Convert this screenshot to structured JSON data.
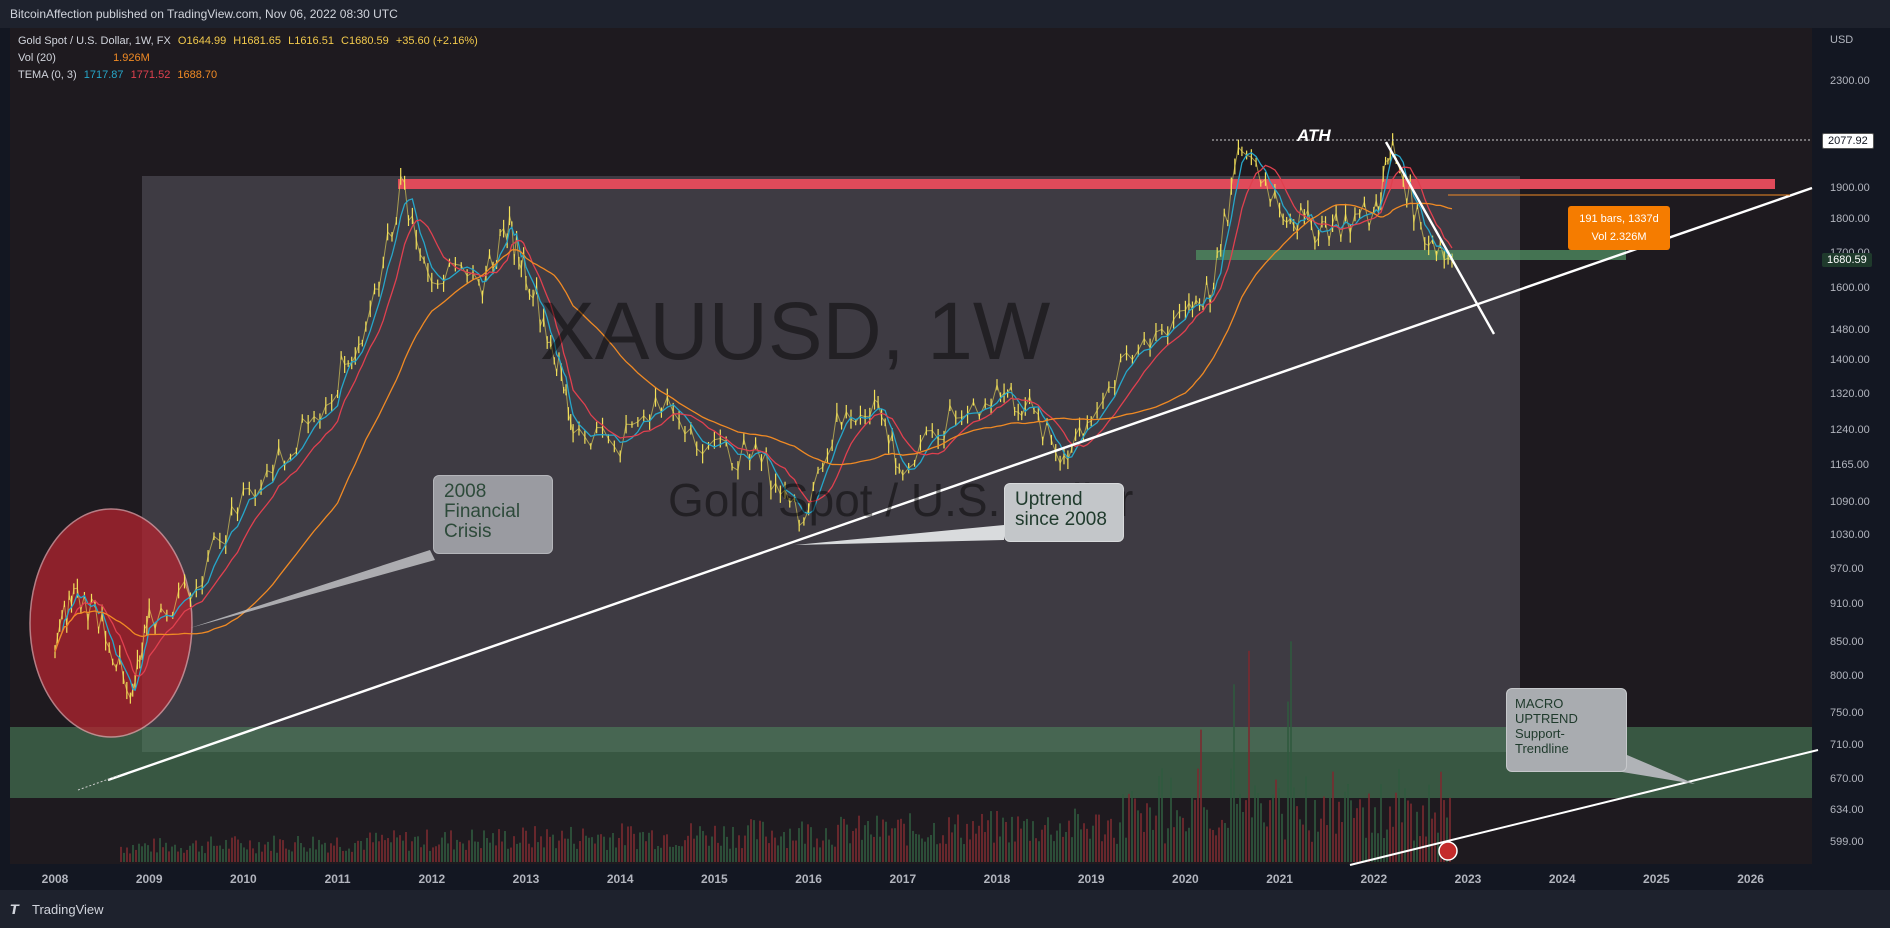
{
  "header": {
    "published": "BitcoinAffection published on TradingView.com, Nov 06, 2022 08:30 UTC"
  },
  "legend": {
    "symbol": "Gold Spot / U.S. Dollar, 1W, FX",
    "ohlc": [
      "O1644.99",
      "H1681.65",
      "L1616.51",
      "C1680.59",
      "+35.60 (+2.16%)"
    ],
    "vol_label": "Vol (20)",
    "vol_value": "1.926M",
    "tema_label": "TEMA (0, 3)",
    "tema_values": [
      "1717.87",
      "1771.52",
      "1688.70"
    ]
  },
  "watermark": {
    "ticker": "XAUUSD, 1W",
    "name": "Gold Spot / U.S. Dollar"
  },
  "annotations": {
    "ath": "ATH",
    "crisis": [
      "2008",
      "Financial",
      "Crisis"
    ],
    "uptrend": [
      "Uptrend",
      "since 2008"
    ],
    "macro": [
      "MACRO",
      "UPTREND",
      "Support-",
      "Trendline"
    ],
    "bars_box": [
      "191 bars, 1337d",
      "Vol 2.326M"
    ]
  },
  "axis": {
    "currency": "USD",
    "price_ticks": [
      "2300.00",
      "2077.92",
      "1900.00",
      "1800.00",
      "1700.00",
      "1600.00",
      "1480.00",
      "1400.00",
      "1320.00",
      "1240.00",
      "1165.00",
      "1090.00",
      "1030.00",
      "970.00",
      "910.00",
      "850.00",
      "800.00",
      "750.00",
      "710.00",
      "670.00",
      "634.00",
      "599.00"
    ],
    "time_ticks": [
      "2008",
      "2009",
      "2010",
      "2011",
      "2012",
      "2013",
      "2014",
      "2015",
      "2016",
      "2017",
      "2018",
      "2019",
      "2020",
      "2021",
      "2022",
      "2023",
      "2024",
      "2025",
      "2026"
    ],
    "ath_badge": "2077.92",
    "last_badge": "1680.59"
  },
  "footer": {
    "brand": "TradingView"
  },
  "colors": {
    "price": "#f2e05a",
    "tema_fast": "#26a6c9",
    "tema_mid": "#e0404f",
    "tema_slow": "#f08a24",
    "resistance": "#e04a5a",
    "support_zone": "#4e8a5f"
  },
  "chart_data": {
    "type": "line",
    "title": "Gold Spot / U.S. Dollar, 1W, FX",
    "x": [
      2008.0,
      2008.2,
      2008.5,
      2008.8,
      2009.0,
      2009.5,
      2010.0,
      2010.5,
      2011.0,
      2011.3,
      2011.67,
      2012.0,
      2012.5,
      2012.8,
      2013.0,
      2013.3,
      2013.5,
      2014.0,
      2014.5,
      2015.0,
      2015.5,
      2015.9,
      2016.3,
      2016.7,
      2017.0,
      2017.5,
      2018.0,
      2018.3,
      2018.67,
      2019.0,
      2019.5,
      2020.0,
      2020.3,
      2020.6,
      2021.0,
      2021.3,
      2021.6,
      2022.0,
      2022.2,
      2022.5,
      2022.83
    ],
    "series": [
      {
        "values": [
          850,
          930,
          890,
          760,
          880,
          950,
          1100,
          1200,
          1360,
          1480,
          1900,
          1650,
          1600,
          1780,
          1660,
          1420,
          1250,
          1220,
          1300,
          1200,
          1180,
          1060,
          1250,
          1310,
          1150,
          1260,
          1330,
          1300,
          1180,
          1280,
          1420,
          1550,
          1600,
          2060,
          1850,
          1780,
          1790,
          1820,
          2040,
          1780,
          1680
        ]
      }
    ],
    "ylabel": "USD",
    "ylim": [
      590,
      2400
    ],
    "log_scale": true,
    "grid": false,
    "levels": {
      "ath": 2077.92,
      "last": 1680.59
    }
  }
}
